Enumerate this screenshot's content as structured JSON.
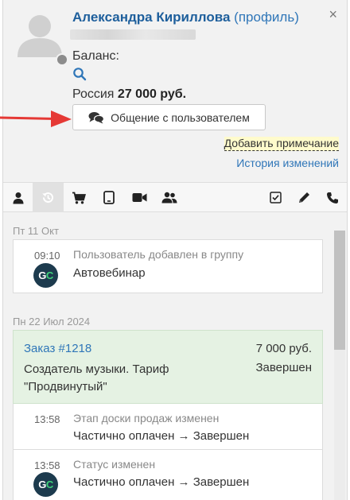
{
  "header": {
    "user_name": "Александра Кириллова",
    "profile_link": "(профиль)",
    "close": "×",
    "balance_label": "Баланс:",
    "country": "Россия",
    "amount": "27 000 руб.",
    "chat_button": "Общение с пользователем",
    "add_note": "Добавить примечание",
    "history_link": "История изменений"
  },
  "toolbar": {
    "icons": [
      "user-icon",
      "history-icon",
      "cart-icon",
      "tablet-icon",
      "video-icon",
      "group-icon",
      "checkbox-icon",
      "pencil-icon",
      "phone-icon"
    ],
    "active": "history-icon"
  },
  "timeline": {
    "groups": [
      {
        "date": "Пт 11 Окт",
        "events": [
          {
            "time": "09:10",
            "title": "Пользователь добавлен в группу",
            "detail": "Автовебинар"
          }
        ]
      },
      {
        "date": "Пн 22 Июл 2024",
        "order": {
          "link": "Заказ #1218",
          "description": "Создатель музыки. Тариф \"Продвинутый\"",
          "amount": "7 000 руб.",
          "status": "Завершен"
        },
        "events": [
          {
            "time": "13:58",
            "title": "Этап доски продаж изменен",
            "detail": "Частично оплачен → Завершен"
          },
          {
            "time": "13:58",
            "title": "Статус изменен",
            "detail": "Частично оплачен → Завершен"
          }
        ]
      }
    ]
  },
  "logo": {
    "left": "G",
    "right": "C"
  },
  "colors": {
    "link": "#2f76b8",
    "annotation_arrow": "#e53935",
    "order_bg": "#e5f2e3",
    "note_highlight": "#fffbcc"
  }
}
